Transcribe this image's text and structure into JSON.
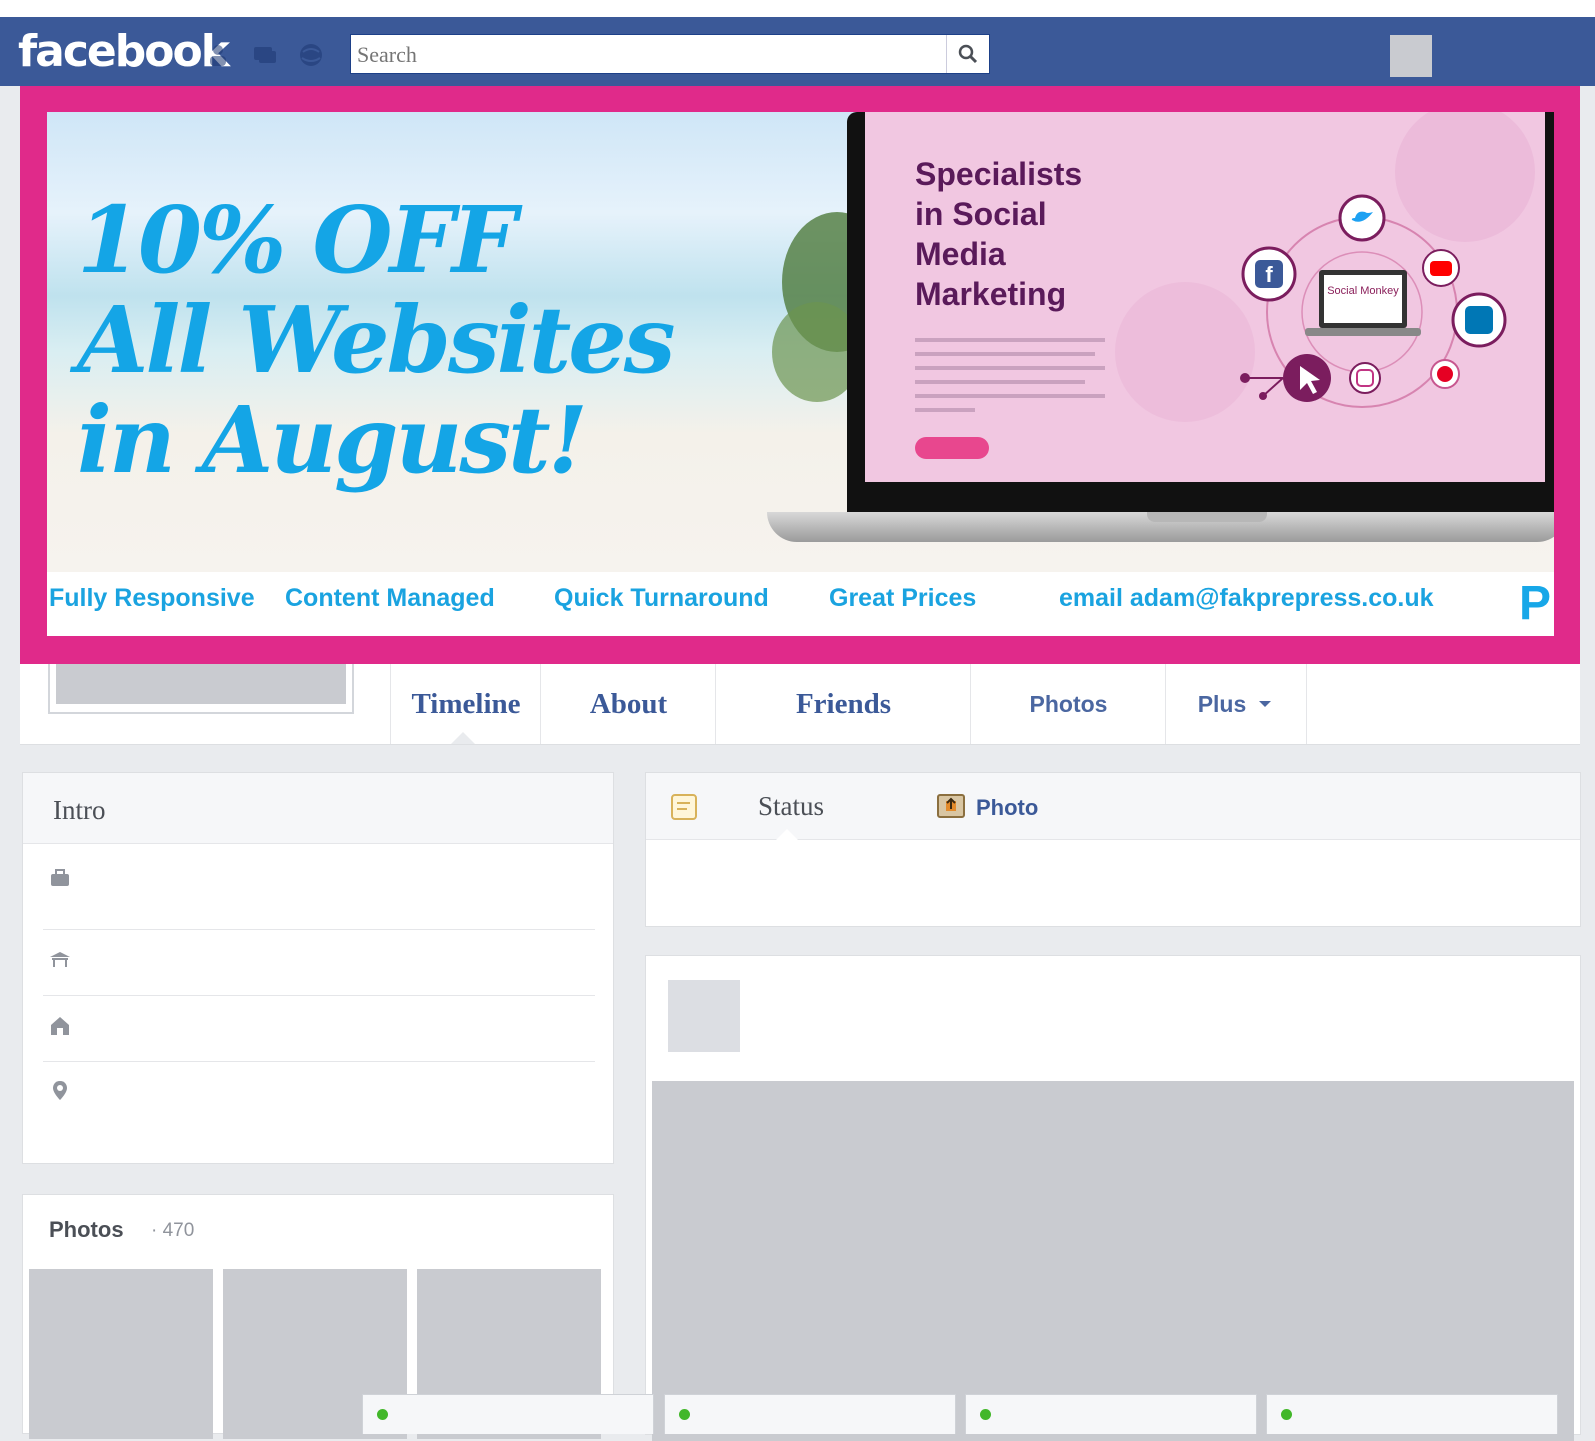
{
  "app": {
    "logo_text": "facebook"
  },
  "search": {
    "placeholder": "Search"
  },
  "cover": {
    "promo_lines": [
      "10% OFF",
      "All Websites",
      "in August!"
    ],
    "ad_headline": [
      "Specialists",
      "in Social",
      "Media",
      "Marketing"
    ],
    "diagram_label": "Social Monkey",
    "features": [
      "Fully Responsive",
      "Content Managed",
      "Quick Turnaround",
      "Great Prices",
      "email adam@fakprepress.co.uk"
    ],
    "brand_letter": "P",
    "colors": {
      "frame": "#e02a8a",
      "text_blue": "#14a5e6",
      "ad_purple": "#5a1a5a"
    }
  },
  "nav": {
    "tabs": [
      "Timeline",
      "About",
      "Friends",
      "Photos",
      "Plus"
    ]
  },
  "intro": {
    "title": "Intro"
  },
  "photos": {
    "title": "Photos",
    "count": "· 470"
  },
  "composer": {
    "status_label": "Status",
    "photo_label": "Photo"
  },
  "theme": {
    "bar_blue": "#3b5998",
    "page_bg": "#e9ebee"
  }
}
